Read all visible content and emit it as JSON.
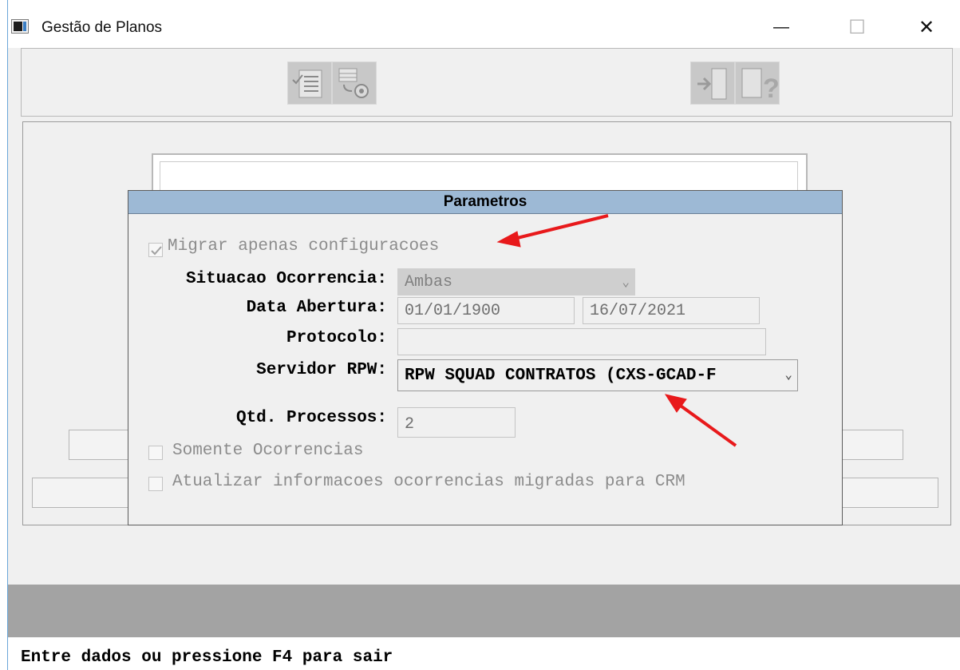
{
  "window": {
    "title": "Gestão de Planos",
    "controls": {
      "minimize": "—",
      "maximize": "☐",
      "close": "✕"
    }
  },
  "toolbar": {
    "buttons": [
      {
        "icon": "checklist-icon"
      },
      {
        "icon": "process-gear-icon"
      },
      {
        "icon": "exit-door-icon"
      },
      {
        "icon": "help-question-icon"
      }
    ]
  },
  "dialog": {
    "title": "Parametros",
    "migrar": {
      "label": "Migrar apenas configuracoes",
      "checked": true
    },
    "situacao": {
      "label": "Situacao Ocorrencia:",
      "value": "Ambas"
    },
    "data_abertura": {
      "label": "Data Abertura:",
      "from": "01/01/1900",
      "to": "16/07/2021"
    },
    "protocolo": {
      "label": "Protocolo:",
      "value": ""
    },
    "servidor": {
      "label": "Servidor RPW:",
      "value": "RPW SQUAD CONTRATOS (CXS-GCAD-F"
    },
    "qtd_processos": {
      "label": "Qtd. Processos:",
      "value": "2"
    },
    "somente": {
      "label": "Somente Ocorrencias",
      "checked": false
    },
    "atualizar": {
      "label": "Atualizar informacoes ocorrencias migradas para CRM",
      "checked": false
    }
  },
  "status": {
    "text": "Entre dados ou pressione F4 para sair"
  },
  "colors": {
    "dialog_title_bg": "#9db9d5",
    "annotation_arrow": "#e8191b",
    "status_band": "#a3a3a3"
  }
}
